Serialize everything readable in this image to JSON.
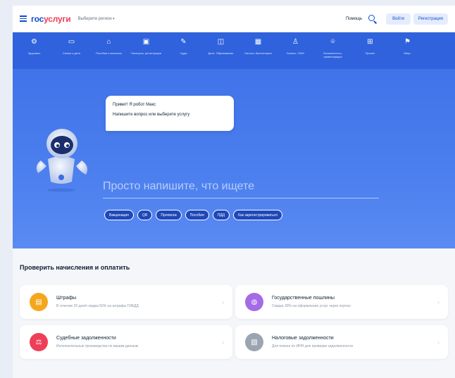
{
  "header": {
    "logo_part1": "гос",
    "logo_part2": "услуги",
    "region": "Выберите регион",
    "help": "Помощь",
    "login": "Войти",
    "register": "Регистрация"
  },
  "nav": [
    {
      "icon": "car-icon",
      "glyph": "⚙",
      "label": "Здоровье"
    },
    {
      "icon": "folder-icon",
      "glyph": "▭",
      "label": "Семья и дети"
    },
    {
      "icon": "home-icon",
      "glyph": "⌂",
      "label": "Пособия и выплаты"
    },
    {
      "icon": "doc-icon",
      "glyph": "▣",
      "label": "Паспорта, регистрации"
    },
    {
      "icon": "pen-icon",
      "glyph": "✎",
      "label": "Суды"
    },
    {
      "icon": "book-icon",
      "glyph": "◫",
      "label": "Дети. Образование"
    },
    {
      "icon": "building-icon",
      "glyph": "▦",
      "label": "Налоги, бухгалтерия"
    },
    {
      "icon": "people-icon",
      "glyph": "♙",
      "label": "Бизнес, СМИ"
    },
    {
      "icon": "shield-icon",
      "glyph": "⌾",
      "label": "Безопасность, правопорядок"
    },
    {
      "icon": "grid-icon",
      "glyph": "⊞",
      "label": "Прочее"
    },
    {
      "icon": "flag-icon",
      "glyph": "⚑",
      "label": "Мигр."
    }
  ],
  "assistant": {
    "line1": "Привет! Я робот Макс",
    "line2": "Напишите вопрос или выберите услугу",
    "prompt": "Просто напишите, что ищете"
  },
  "chips": [
    "Вакцинация",
    "QR",
    "Прописка",
    "Пособия",
    "ПДД",
    "Как зарегистрироваться"
  ],
  "section": {
    "title": "Проверить начисления и оплатить"
  },
  "cards": [
    {
      "title": "Штрафы",
      "subtitle": "В течение 20 дней скидка 50% на штрафы ГИБДД",
      "color": "#f4a71d",
      "icon": "receipt-icon",
      "glyph": "▤"
    },
    {
      "title": "Государственные пошлины",
      "subtitle": "Скидка 30% на оформление услуг через портал",
      "color": "#a56ae6",
      "icon": "coins-icon",
      "glyph": "◍"
    },
    {
      "title": "Судебные задолженности",
      "subtitle": "Исполнительные производства по вашим данным",
      "color": "#ee3f58",
      "icon": "gavel-icon",
      "glyph": "⚖"
    },
    {
      "title": "Налоговые задолженности",
      "subtitle": "Для поиска по ИНН для проверки задолженности",
      "color": "#9aa5b1",
      "icon": "tax-icon",
      "glyph": "▧"
    }
  ]
}
